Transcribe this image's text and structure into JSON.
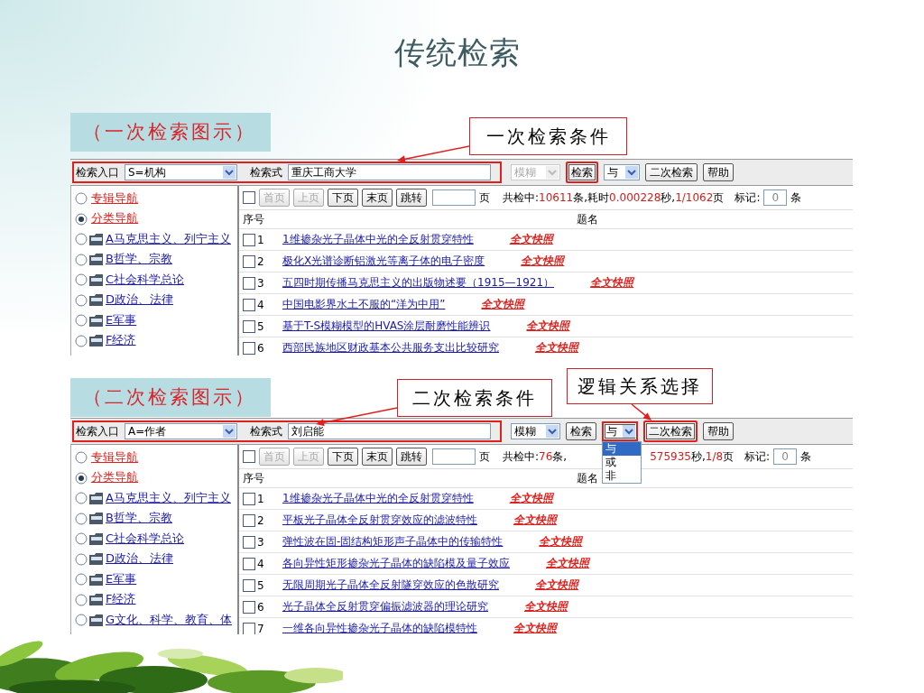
{
  "title": "传统检索",
  "panels": [
    {
      "caption": "（一次检索图示）",
      "callouts": [
        {
          "text": "一次检索条件",
          "kind": "condition"
        }
      ],
      "toolbar": {
        "entry_label": "检索入口",
        "entry_value": "S=机构",
        "expr_label": "检索式",
        "expr_value": "重庆工商大学",
        "mode": {
          "value": "模糊",
          "disabled": true
        },
        "buttons": [
          {
            "label": "检索",
            "kind": "button",
            "highlighted": true
          },
          {
            "label": "与",
            "kind": "select",
            "highlighted": false
          },
          {
            "label": "二次检索",
            "kind": "button",
            "highlighted": false
          },
          {
            "label": "帮助",
            "kind": "button",
            "highlighted": false
          }
        ]
      },
      "pager": {
        "buttons": [
          {
            "label": "首页",
            "disabled": true
          },
          {
            "label": "上页",
            "disabled": true
          },
          {
            "label": "下页",
            "disabled": false
          },
          {
            "label": "末页",
            "disabled": false
          },
          {
            "label": "跳转",
            "disabled": false
          }
        ],
        "select_all_checked": false,
        "page_label": "页",
        "status": [
          {
            "text": "共检中:",
            "kind": "plain"
          },
          {
            "text": "10611",
            "kind": "value"
          },
          {
            "text": "条,耗时",
            "kind": "plain"
          },
          {
            "text": "0.000228",
            "kind": "value"
          },
          {
            "text": "秒,",
            "kind": "plain"
          },
          {
            "text": "1/1062",
            "kind": "value"
          },
          {
            "text": "页",
            "kind": "plain"
          }
        ],
        "mark_label": "标记:",
        "mark_value": "0",
        "mark_unit": "条"
      },
      "nav": [
        {
          "label": "专辑导航",
          "kind": "radio",
          "selected": false
        },
        {
          "label": "分类导航",
          "kind": "radio",
          "selected": true
        },
        {
          "label": "A马克思主义、列宁主义",
          "kind": "folder",
          "selected": false
        },
        {
          "label": "B哲学、宗教",
          "kind": "folder",
          "selected": false
        },
        {
          "label": "C社会科学总论",
          "kind": "folder",
          "selected": false
        },
        {
          "label": "D政治、法律",
          "kind": "folder",
          "selected": false
        },
        {
          "label": "E军事",
          "kind": "folder",
          "selected": false
        },
        {
          "label": "F经济",
          "kind": "folder",
          "selected": false
        }
      ],
      "table": {
        "columns": [
          "序号",
          "题名"
        ],
        "rows": [
          {
            "no": "1",
            "title": "1维掺杂光子晶体中光的全反射贯穿特性",
            "link": "全文快照",
            "checked": false
          },
          {
            "no": "2",
            "title": "极化X光谱诊断铝激光等离子体的电子密度",
            "link": "全文快照",
            "checked": false
          },
          {
            "no": "3",
            "title": "五四时期传播马克思主义的出版物述要（1915—1921）",
            "link": "全文快照",
            "checked": false
          },
          {
            "no": "4",
            "title": "中国电影界水土不服的“洋为中用”",
            "link": "全文快照",
            "checked": false
          },
          {
            "no": "5",
            "title": "基于T-S模糊模型的HVAS涂层耐磨性能辨识",
            "link": "全文快照",
            "checked": false
          },
          {
            "no": "6",
            "title": "西部民族地区财政基本公共服务支出比较研究",
            "link": "全文快照",
            "checked": false
          }
        ]
      }
    },
    {
      "caption": "（二次检索图示）",
      "callouts": [
        {
          "text": "二次检索条件",
          "kind": "condition"
        },
        {
          "text": "逻辑关系选择",
          "kind": "logic"
        }
      ],
      "toolbar": {
        "entry_label": "检索入口",
        "entry_value": "A=作者",
        "expr_label": "检索式",
        "expr_value": "刘启能",
        "mode": {
          "value": "模糊",
          "disabled": false
        },
        "buttons": [
          {
            "label": "检索",
            "kind": "button",
            "highlighted": false
          },
          {
            "label": "与",
            "kind": "select",
            "highlighted": true
          },
          {
            "label": "二次检索",
            "kind": "button",
            "highlighted": true
          },
          {
            "label": "帮助",
            "kind": "button",
            "highlighted": false
          }
        ],
        "menu": [
          {
            "label": "与",
            "selected": true
          },
          {
            "label": "或",
            "selected": false
          },
          {
            "label": "非",
            "selected": false
          }
        ]
      },
      "pager": {
        "buttons": [
          {
            "label": "首页",
            "disabled": true
          },
          {
            "label": "上页",
            "disabled": true
          },
          {
            "label": "下页",
            "disabled": false
          },
          {
            "label": "末页",
            "disabled": false
          },
          {
            "label": "跳转",
            "disabled": false
          }
        ],
        "select_all_checked": false,
        "page_label": "页",
        "status": [
          {
            "text": "共检中:",
            "kind": "plain"
          },
          {
            "text": "76",
            "kind": "value"
          },
          {
            "text": "条,",
            "kind": "plain"
          },
          {
            "text": "575935",
            "kind": "offset"
          },
          {
            "text": "秒,",
            "kind": "plain"
          },
          {
            "text": "1/8",
            "kind": "value"
          },
          {
            "text": "页",
            "kind": "plain"
          }
        ],
        "mark_label": "标记:",
        "mark_value": "0",
        "mark_unit": "条"
      },
      "nav": [
        {
          "label": "专辑导航",
          "kind": "radio",
          "selected": false
        },
        {
          "label": "分类导航",
          "kind": "radio",
          "selected": true
        },
        {
          "label": "A马克思主义、列宁主义",
          "kind": "folder",
          "selected": false
        },
        {
          "label": "B哲学、宗教",
          "kind": "folder",
          "selected": false
        },
        {
          "label": "C社会科学总论",
          "kind": "folder",
          "selected": false
        },
        {
          "label": "D政治、法律",
          "kind": "folder",
          "selected": false
        },
        {
          "label": "E军事",
          "kind": "folder",
          "selected": false
        },
        {
          "label": "F经济",
          "kind": "folder",
          "selected": false
        },
        {
          "label": "G文化、科学、教育、体",
          "kind": "folder",
          "selected": false
        }
      ],
      "table": {
        "columns": [
          "序号",
          "题名"
        ],
        "rows": [
          {
            "no": "1",
            "title": "1维掺杂光子晶体中光的全反射贯穿特性",
            "link": "全文快照",
            "checked": false
          },
          {
            "no": "2",
            "title": "平板光子晶体全反射贯穿效应的滤波特性",
            "link": "全文快照",
            "checked": false
          },
          {
            "no": "3",
            "title": "弹性波在固-固结构矩形声子晶体中的传输特性",
            "link": "全文快照",
            "checked": false
          },
          {
            "no": "4",
            "title": "各向异性矩形掺杂光子晶体的缺陷模及量子效应",
            "link": "全文快照",
            "checked": false
          },
          {
            "no": "5",
            "title": "无限周期光子晶体全反射隧穿效应的色散研究",
            "link": "全文快照",
            "checked": false
          },
          {
            "no": "6",
            "title": "光子晶体全反射贯穿偏振滤波器的理论研究",
            "link": "全文快照",
            "checked": false
          },
          {
            "no": "7",
            "title": "一维各向异性掺杂光子晶体的缺陷模特性",
            "link": "全文快照",
            "checked": false
          }
        ]
      }
    }
  ]
}
